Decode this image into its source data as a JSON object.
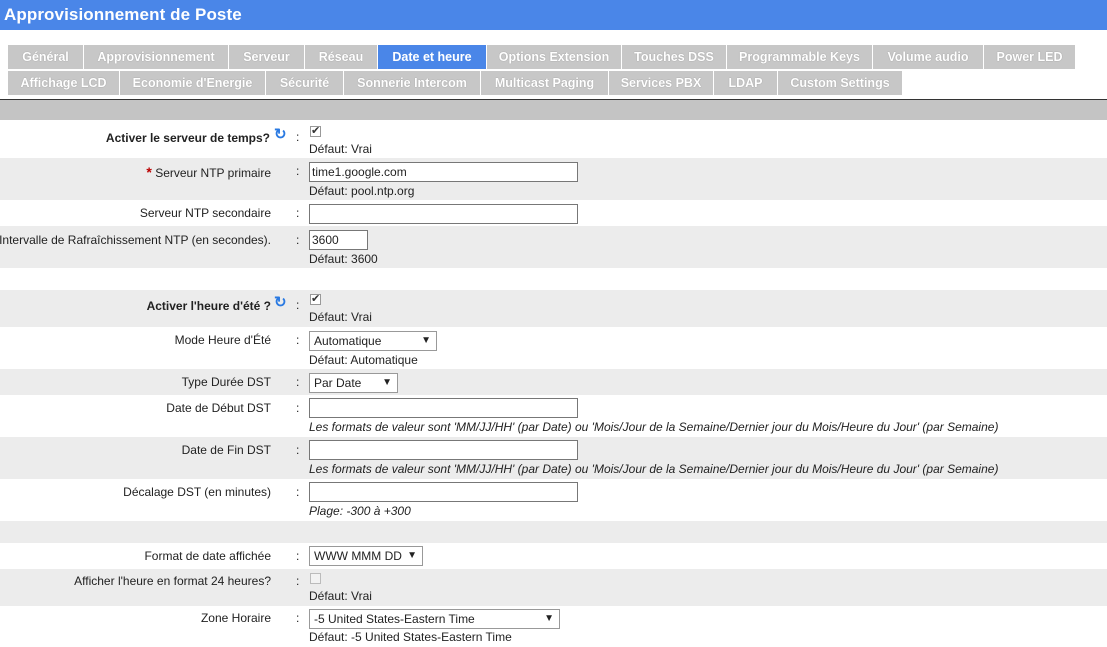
{
  "header": {
    "title": "Approvisionnement de Poste"
  },
  "tabs": [
    "Général",
    "Approvisionnement",
    "Serveur",
    "Réseau",
    "Date et heure",
    "Options Extension",
    "Touches DSS",
    "Programmable Keys",
    "Volume audio",
    "Power LED",
    "Affichage LCD",
    "Economie d'Energie",
    "Sécurité",
    "Sonnerie Intercom",
    "Multicast Paging",
    "Services PBX",
    "LDAP",
    "Custom Settings"
  ],
  "active_tab": "Date et heure",
  "colon": ":",
  "fields": {
    "time_server": {
      "label": "Activer le serveur de temps?",
      "default": "Défaut: Vrai",
      "checked": true
    },
    "ntp_primary": {
      "required_mark": "*",
      "label": "Serveur NTP primaire",
      "value": "time1.google.com",
      "default": "Défaut: pool.ntp.org"
    },
    "ntp_secondary": {
      "label": "Serveur NTP secondaire",
      "value": ""
    },
    "ntp_interval": {
      "label": "Intervalle de Rafraîchissement NTP (en secondes).",
      "value": "3600",
      "default": "Défaut: 3600"
    },
    "dst_enable": {
      "label": "Activer l'heure d'été ?",
      "default": "Défaut: Vrai",
      "checked": true
    },
    "dst_mode": {
      "label": "Mode Heure d'Été",
      "value": "Automatique",
      "default": "Défaut: Automatique"
    },
    "dst_type": {
      "label": "Type Durée DST",
      "value": "Par Date"
    },
    "dst_start": {
      "label": "Date de Début DST",
      "value": "",
      "hint": "Les formats de valeur sont 'MM/JJ/HH' (par Date) ou 'Mois/Jour de la Semaine/Dernier jour du Mois/Heure du Jour' (par Semaine)"
    },
    "dst_end": {
      "label": "Date de Fin DST",
      "value": "",
      "hint": "Les formats de valeur sont 'MM/JJ/HH' (par Date) ou 'Mois/Jour de la Semaine/Dernier jour du Mois/Heure du Jour' (par Semaine)"
    },
    "dst_offset": {
      "label": "Décalage DST (en minutes)",
      "value": "",
      "hint": "Plage: -300 à +300"
    },
    "date_format": {
      "label": "Format de date affichée",
      "value": "WWW MMM DD"
    },
    "hour24": {
      "label": "Afficher l'heure en format 24 heures?",
      "default": "Défaut: Vrai",
      "checked": false
    },
    "timezone": {
      "label": "Zone Horaire",
      "value": "-5 United States-Eastern Time",
      "default": "Défaut: -5 United States-Eastern Time"
    }
  },
  "icons": {
    "refresh": "refresh-icon",
    "dropdown": "chevron-down-icon",
    "check": "checkmark-icon"
  },
  "colors": {
    "header": "#4a86e8",
    "tab_inactive": "#c7c7c7",
    "row_alt": "#ececec",
    "required": "#b00000"
  }
}
